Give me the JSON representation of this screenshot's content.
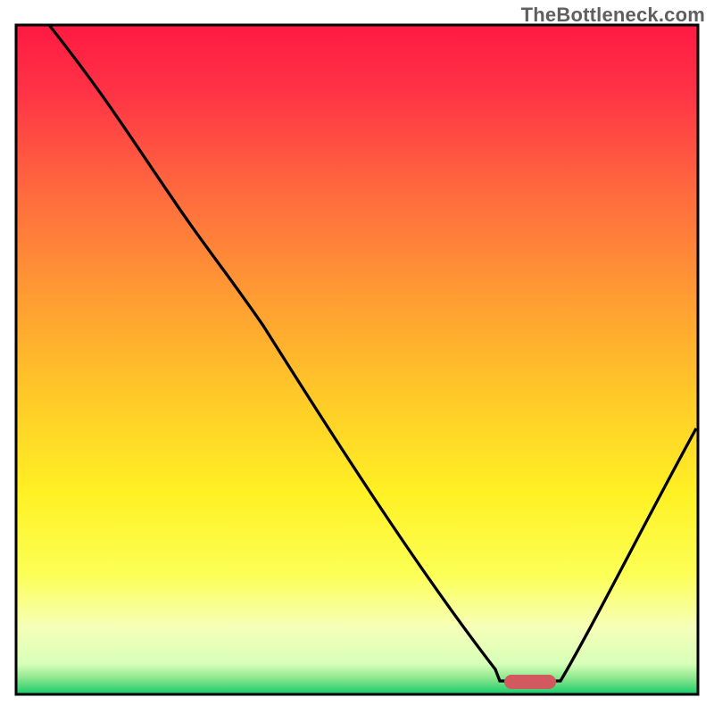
{
  "watermark": "TheBottleneck.com",
  "colors": {
    "gradient_top": "#ff1a42",
    "gradient_mid": "#ffc828",
    "gradient_bottom": "#17c96b",
    "curve": "#000000",
    "marker": "#d1595f",
    "border": "#000000"
  },
  "chart_data": {
    "type": "line",
    "title": "",
    "xlabel": "",
    "ylabel": "",
    "xlim": [
      0,
      100
    ],
    "ylim": [
      0,
      100
    ],
    "series": [
      {
        "name": "bottleneck-curve",
        "x": [
          5,
          12,
          20,
          28,
          36,
          44,
          52,
          60,
          68,
          72,
          78,
          82,
          90,
          100
        ],
        "values": [
          100,
          88,
          76,
          66,
          56,
          46,
          36,
          26,
          12,
          2,
          0,
          0,
          18,
          40
        ]
      }
    ],
    "markers": [
      {
        "name": "optimal-range",
        "x_start": 72,
        "x_end": 80,
        "y": 0
      }
    ],
    "background_scale": {
      "description": "vertical color scale where green≈0 bottleneck, red≈high",
      "stops": [
        {
          "pos": 0.0,
          "color": "#ff1a42"
        },
        {
          "pos": 0.55,
          "color": "#ffc828"
        },
        {
          "pos": 0.82,
          "color": "#fcff55"
        },
        {
          "pos": 1.0,
          "color": "#17c96b"
        }
      ]
    }
  }
}
